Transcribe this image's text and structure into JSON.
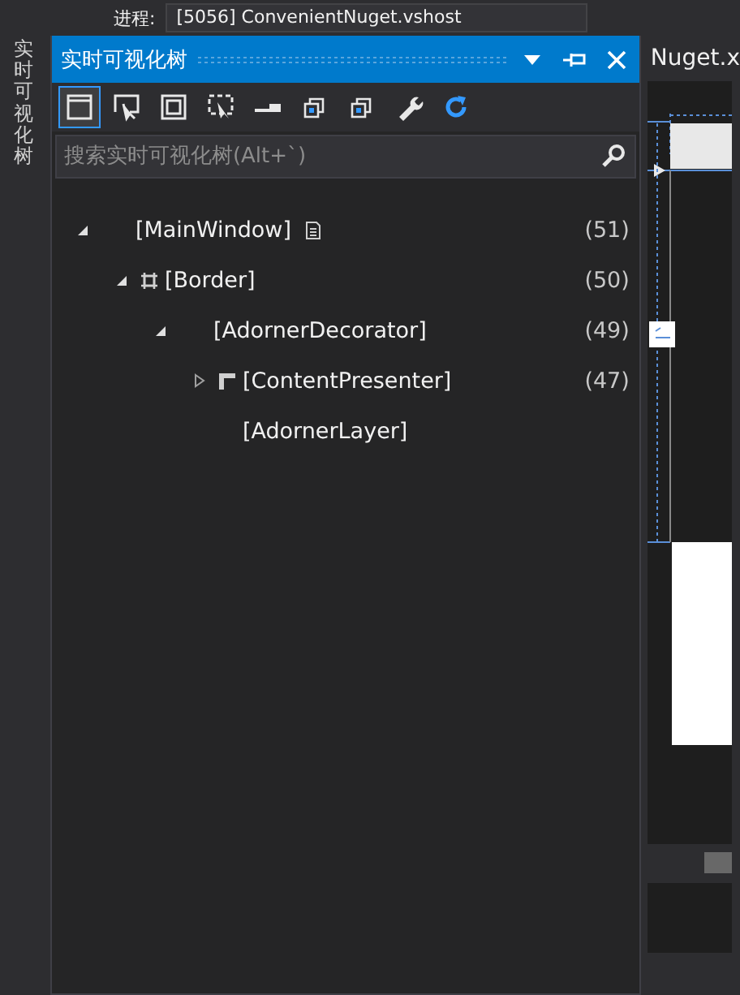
{
  "top_bar": {
    "label": "进程:",
    "process": "[5056] ConvenientNuget.vshost"
  },
  "side_tab": {
    "label": "实时可视化树"
  },
  "panel": {
    "title": "实时可视化树",
    "search": {
      "placeholder": "搜索实时可视化树(Alt+`)"
    },
    "toolbar": [
      {
        "kind": "window",
        "selected": true
      },
      {
        "kind": "pick",
        "selected": false
      },
      {
        "kind": "frame",
        "selected": false
      },
      {
        "kind": "select",
        "selected": false
      },
      {
        "kind": "bar",
        "selected": false
      },
      {
        "kind": "stack",
        "selected": false
      },
      {
        "kind": "stack",
        "selected": false
      },
      {
        "kind": "wrench",
        "selected": false
      },
      {
        "kind": "refresh",
        "selected": false
      }
    ],
    "tree": [
      {
        "label": "[MainWindow]",
        "kind": "window",
        "count": "(51)",
        "expanded": true,
        "children": [
          {
            "label": "[Border]",
            "kind": "border",
            "count": "(50)",
            "expanded": true,
            "children": [
              {
                "label": "[AdornerDecorator]",
                "kind": "plain",
                "count": "(49)",
                "expanded": true,
                "children": [
                  {
                    "label": "[ContentPresenter]",
                    "kind": "presenter",
                    "count": "(47)",
                    "expanded": false
                  },
                  {
                    "label": "[AdornerLayer]",
                    "kind": "plain"
                  }
                ]
              }
            ]
          }
        ]
      }
    ]
  },
  "document_tab": {
    "label": "Nuget.x"
  }
}
